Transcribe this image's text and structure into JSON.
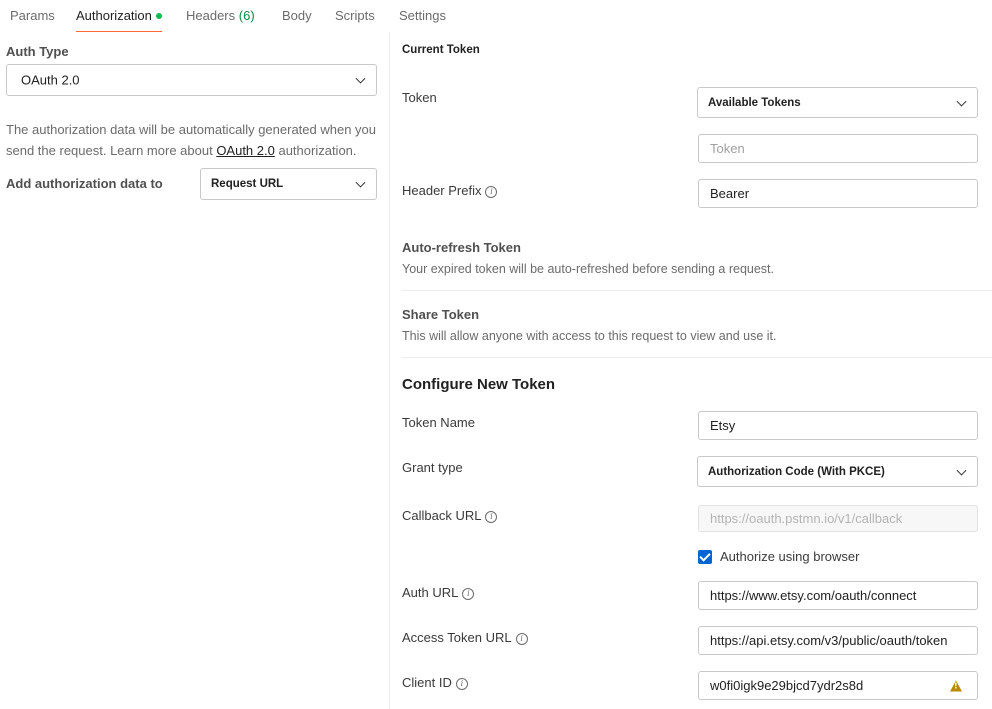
{
  "tabs": [
    {
      "label": "Params"
    },
    {
      "label": "Authorization"
    },
    {
      "label": "Headers",
      "count": "(6)"
    },
    {
      "label": "Body"
    },
    {
      "label": "Scripts"
    },
    {
      "label": "Settings"
    }
  ],
  "left": {
    "auth_type_label": "Auth Type",
    "auth_type_value": "OAuth 2.0",
    "description_before": "The authorization data will be automatically generated when you send the request. Learn more about ",
    "description_link": "OAuth 2.0",
    "description_after": " authorization.",
    "add_to_label": "Add authorization data to",
    "add_to_value": "Request URL"
  },
  "current_token": {
    "title": "Current Token",
    "token_label": "Token",
    "token_select": "Available Tokens",
    "token_placeholder": "Token",
    "header_prefix_label": "Header Prefix",
    "header_prefix_value": "Bearer"
  },
  "auto_refresh": {
    "title": "Auto-refresh Token",
    "desc": "Your expired token will be auto-refreshed before sending a request."
  },
  "share": {
    "title": "Share Token",
    "desc": "This will allow anyone with access to this request to view and use it."
  },
  "configure": {
    "title": "Configure New Token",
    "token_name_label": "Token Name",
    "token_name_value": "Etsy",
    "grant_type_label": "Grant type",
    "grant_type_value": "Authorization Code (With PKCE)",
    "callback_label": "Callback URL",
    "callback_placeholder": "https://oauth.pstmn.io/v1/callback",
    "authorize_browser_label": "Authorize using browser",
    "auth_url_label": "Auth URL",
    "auth_url_value": "https://www.etsy.com/oauth/connect",
    "access_token_url_label": "Access Token URL",
    "access_token_url_value": "https://api.etsy.com/v3/public/oauth/token",
    "client_id_label": "Client ID",
    "client_id_value": "w0fi0igk9e29bjcd7ydr2s8d"
  },
  "colors": {
    "accent": "#ff6c37",
    "status_dot": "#0cbb52",
    "checkbox": "#0265d2",
    "warning": "#b98900"
  }
}
